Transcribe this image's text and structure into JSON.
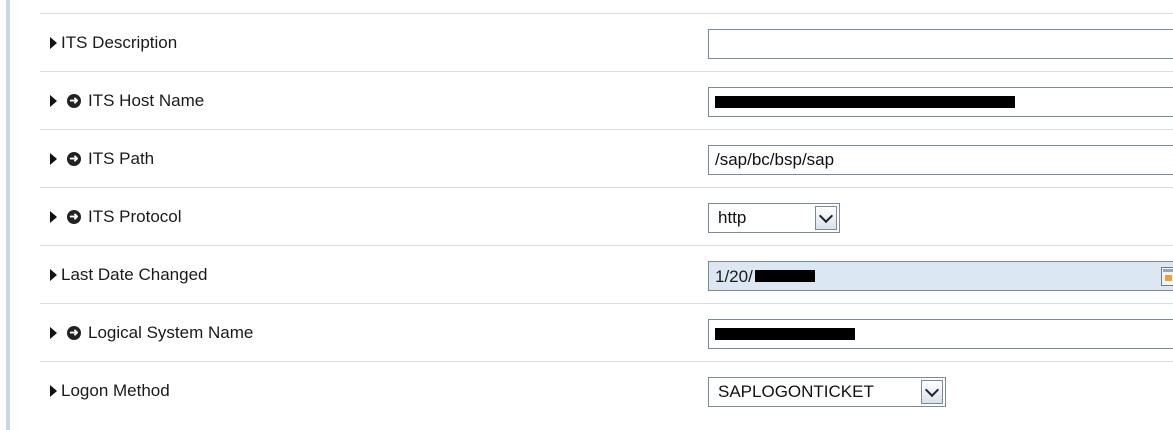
{
  "rows": [
    {
      "label": "ITS Description",
      "required": false,
      "value": "",
      "type": "text"
    },
    {
      "label": "ITS Host Name",
      "required": true,
      "value": "",
      "type": "text"
    },
    {
      "label": "ITS Path",
      "required": true,
      "value": "/sap/bc/bsp/sap",
      "type": "text"
    },
    {
      "label": "ITS Protocol",
      "required": true,
      "value": "http",
      "type": "select"
    },
    {
      "label": "Last Date Changed",
      "required": false,
      "value": "1/20/",
      "type": "date"
    },
    {
      "label": "Logical System Name",
      "required": true,
      "value": "",
      "type": "text"
    },
    {
      "label": "Logon Method",
      "required": false,
      "value": "SAPLOGONTICKET",
      "type": "select"
    }
  ],
  "icons": {
    "expand": "triangle-right-icon",
    "required": "circle-arrow-icon",
    "calendar": "calendar-icon",
    "dropdown": "chevron-down-icon"
  }
}
